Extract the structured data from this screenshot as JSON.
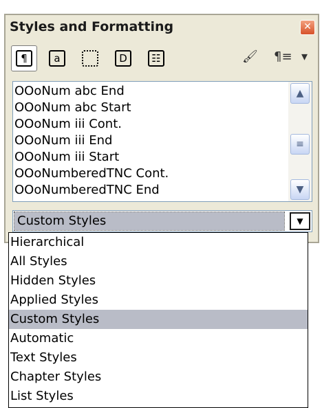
{
  "panel": {
    "title": "Styles and Formatting"
  },
  "toolbar": {
    "tools": [
      {
        "icon": "paragraph-styles-icon",
        "glyph": "¶",
        "active": true
      },
      {
        "icon": "character-styles-icon",
        "glyph": "a"
      },
      {
        "icon": "frame-styles-icon",
        "glyph": ""
      },
      {
        "icon": "page-styles-icon",
        "glyph": "D"
      },
      {
        "icon": "list-styles-icon",
        "glyph": "☷"
      }
    ],
    "fill_format_glyph": "🖌",
    "new_style_glyph": "¶≡",
    "menu_glyph": "▾"
  },
  "style_list": {
    "items": [
      "OOoNum abc End",
      "OOoNum abc Start",
      "OOoNum iii Cont.",
      "OOoNum iii End",
      "OOoNum iii Start",
      "OOoNumberedTNC Cont.",
      "OOoNumberedTNC End"
    ]
  },
  "filter": {
    "selected": "Custom Styles",
    "options": [
      "Hierarchical",
      "All Styles",
      "Hidden Styles",
      "Applied Styles",
      "Custom Styles",
      "Automatic",
      "Text Styles",
      "Chapter Styles",
      "List Styles"
    ],
    "selected_index": 4
  },
  "colors": {
    "panel_bg": "#ece9d8",
    "selection_bg": "#b9bcc7",
    "close_button": "#d7522a"
  }
}
